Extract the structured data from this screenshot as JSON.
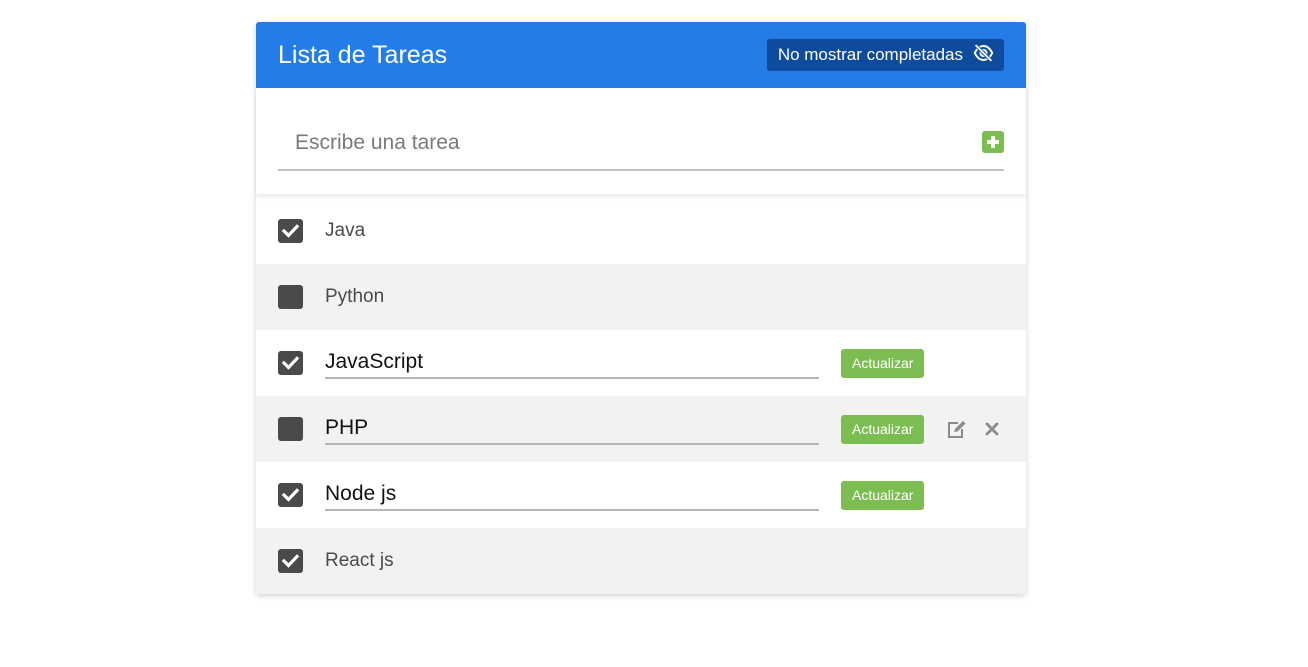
{
  "header": {
    "title": "Lista de Tareas",
    "toggle_label": "No mostrar completadas",
    "toggle_icon": "eye-slash-icon"
  },
  "new_task": {
    "placeholder": "Escribe una tarea",
    "add_icon": "plus-square-icon"
  },
  "tasks": [
    {
      "text": "Java",
      "completed": true,
      "editing": false
    },
    {
      "text": "Python",
      "completed": false,
      "editing": false
    },
    {
      "text": "JavaScript",
      "completed": true,
      "editing": true,
      "update_label": "Actualizar"
    },
    {
      "text": "PHP",
      "completed": false,
      "editing": true,
      "update_label": "Actualizar",
      "show_actions": true
    },
    {
      "text": "Node js",
      "completed": true,
      "editing": true,
      "update_label": "Actualizar"
    },
    {
      "text": "React js",
      "completed": true,
      "editing": false
    }
  ],
  "colors": {
    "header_bg": "#237ce8",
    "toggle_bg": "#0f4b9c",
    "accent_green": "#7cbd51",
    "checkbox": "#4a4a4a",
    "alt_row": "#f2f2f2"
  }
}
